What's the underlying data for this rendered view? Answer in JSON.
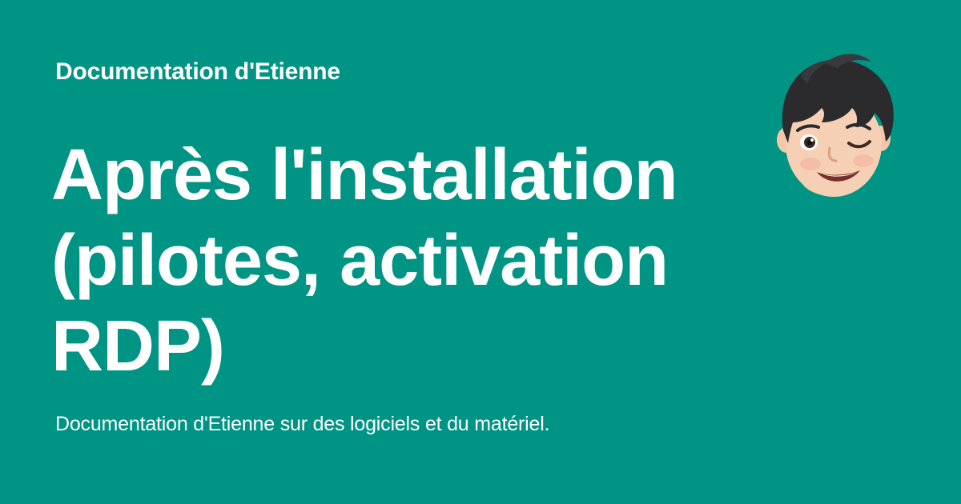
{
  "site": {
    "name": "Documentation d'Etienne"
  },
  "page": {
    "title": "Après l'installation (pilotes, activation RDP)",
    "description": "Documentation d'Etienne sur des logiciels et du matériel."
  },
  "avatar": {
    "icon": "memoji-winking-face-icon"
  },
  "colors": {
    "background": "#009485",
    "text": "#ffffff"
  }
}
